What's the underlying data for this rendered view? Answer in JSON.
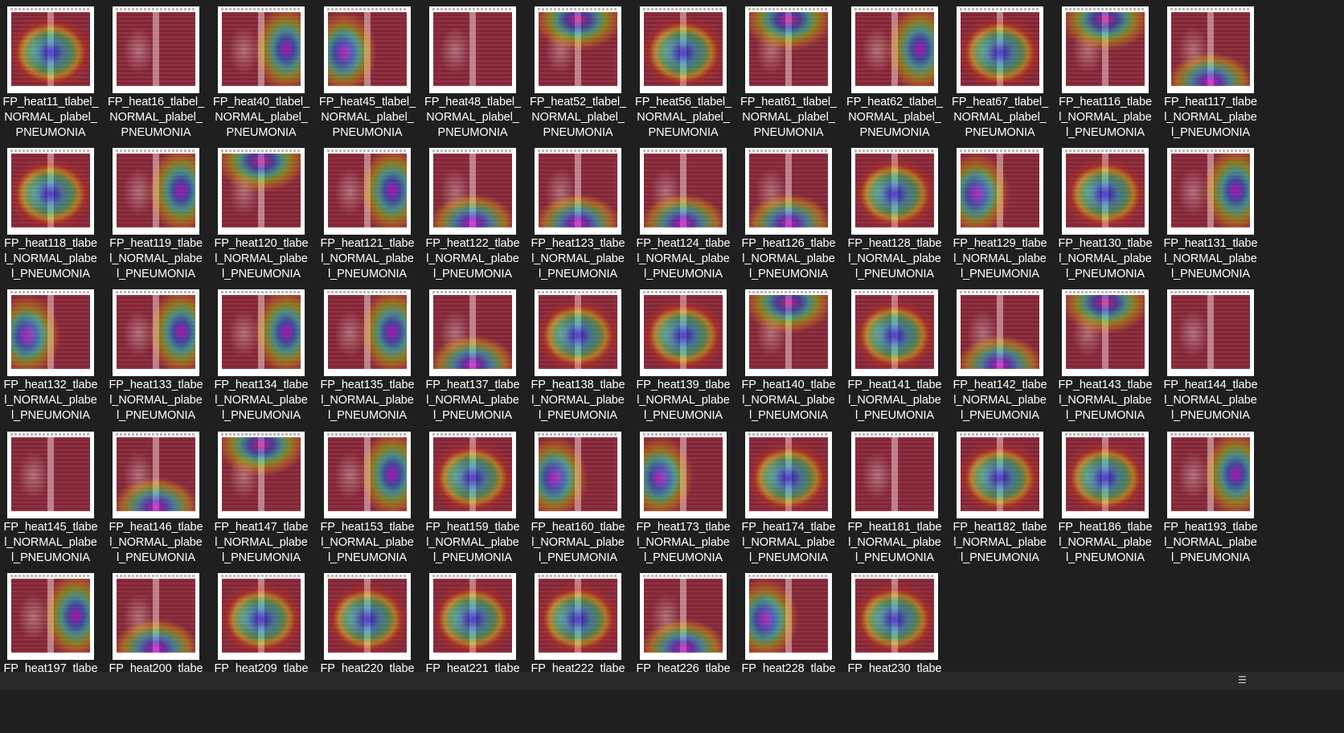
{
  "window": {
    "view": "thumbnails"
  },
  "colors": {
    "background": "#1f1f1f",
    "text": "#ffffff",
    "statusbar": "#2a2a2a"
  },
  "files": [
    {
      "name": "FP_heat11_tlabel_\nNORMAL_plabel_\nPNEUMONIA",
      "heat": "jet-center"
    },
    {
      "name": "FP_heat16_tlabel_\nNORMAL_plabel_\nPNEUMONIA",
      "heat": "none"
    },
    {
      "name": "FP_heat40_tlabel_\nNORMAL_plabel_\nPNEUMONIA",
      "heat": "jet-right"
    },
    {
      "name": "FP_heat45_tlabel_\nNORMAL_plabel_\nPNEUMONIA",
      "heat": "jet-left"
    },
    {
      "name": "FP_heat48_tlabel_\nNORMAL_plabel_\nPNEUMONIA",
      "heat": "none"
    },
    {
      "name": "FP_heat52_tlabel_\nNORMAL_plabel_\nPNEUMONIA",
      "heat": "jet-top"
    },
    {
      "name": "FP_heat56_tlabel_\nNORMAL_plabel_\nPNEUMONIA",
      "heat": "jet-center"
    },
    {
      "name": "FP_heat61_tlabel_\nNORMAL_plabel_\nPNEUMONIA",
      "heat": "jet-top"
    },
    {
      "name": "FP_heat62_tlabel_\nNORMAL_plabel_\nPNEUMONIA",
      "heat": "jet-right"
    },
    {
      "name": "FP_heat67_tlabel_\nNORMAL_plabel_\nPNEUMONIA",
      "heat": "jet-center"
    },
    {
      "name": "FP_heat116_tlabe\nl_NORMAL_plabe\nl_PNEUMONIA",
      "heat": "jet-top"
    },
    {
      "name": "FP_heat117_tlabe\nl_NORMAL_plabe\nl_PNEUMONIA",
      "heat": "jet-bottom"
    },
    {
      "name": "FP_heat118_tlabe\nl_NORMAL_plabe\nl_PNEUMONIA",
      "heat": "jet-center"
    },
    {
      "name": "FP_heat119_tlabe\nl_NORMAL_plabe\nl_PNEUMONIA",
      "heat": "jet-right"
    },
    {
      "name": "FP_heat120_tlabe\nl_NORMAL_plabe\nl_PNEUMONIA",
      "heat": "jet-top"
    },
    {
      "name": "FP_heat121_tlabe\nl_NORMAL_plabe\nl_PNEUMONIA",
      "heat": "jet-right"
    },
    {
      "name": "FP_heat122_tlabe\nl_NORMAL_plabe\nl_PNEUMONIA",
      "heat": "jet-bottom"
    },
    {
      "name": "FP_heat123_tlabe\nl_NORMAL_plabe\nl_PNEUMONIA",
      "heat": "jet-bottom"
    },
    {
      "name": "FP_heat124_tlabe\nl_NORMAL_plabe\nl_PNEUMONIA",
      "heat": "jet-bottom"
    },
    {
      "name": "FP_heat126_tlabe\nl_NORMAL_plabe\nl_PNEUMONIA",
      "heat": "jet-bottom"
    },
    {
      "name": "FP_heat128_tlabe\nl_NORMAL_plabe\nl_PNEUMONIA",
      "heat": "jet-center"
    },
    {
      "name": "FP_heat129_tlabe\nl_NORMAL_plabe\nl_PNEUMONIA",
      "heat": "jet-left"
    },
    {
      "name": "FP_heat130_tlabe\nl_NORMAL_plabe\nl_PNEUMONIA",
      "heat": "jet-center"
    },
    {
      "name": "FP_heat131_tlabe\nl_NORMAL_plabe\nl_PNEUMONIA",
      "heat": "jet-right"
    },
    {
      "name": "FP_heat132_tlabe\nl_NORMAL_plabe\nl_PNEUMONIA",
      "heat": "jet-left"
    },
    {
      "name": "FP_heat133_tlabe\nl_NORMAL_plabe\nl_PNEUMONIA",
      "heat": "jet-right"
    },
    {
      "name": "FP_heat134_tlabe\nl_NORMAL_plabe\nl_PNEUMONIA",
      "heat": "jet-right"
    },
    {
      "name": "FP_heat135_tlabe\nl_NORMAL_plabe\nl_PNEUMONIA",
      "heat": "jet-right"
    },
    {
      "name": "FP_heat137_tlabe\nl_NORMAL_plabe\nl_PNEUMONIA",
      "heat": "jet-bottom"
    },
    {
      "name": "FP_heat138_tlabe\nl_NORMAL_plabe\nl_PNEUMONIA",
      "heat": "jet-center"
    },
    {
      "name": "FP_heat139_tlabe\nl_NORMAL_plabe\nl_PNEUMONIA",
      "heat": "jet-center"
    },
    {
      "name": "FP_heat140_tlabe\nl_NORMAL_plabe\nl_PNEUMONIA",
      "heat": "jet-top"
    },
    {
      "name": "FP_heat141_tlabe\nl_NORMAL_plabe\nl_PNEUMONIA",
      "heat": "jet-center"
    },
    {
      "name": "FP_heat142_tlabe\nl_NORMAL_plabe\nl_PNEUMONIA",
      "heat": "jet-bottom"
    },
    {
      "name": "FP_heat143_tlabe\nl_NORMAL_plabe\nl_PNEUMONIA",
      "heat": "jet-top"
    },
    {
      "name": "FP_heat144_tlabe\nl_NORMAL_plabe\nl_PNEUMONIA",
      "heat": "none"
    },
    {
      "name": "FP_heat145_tlabe\nl_NORMAL_plabe\nl_PNEUMONIA",
      "heat": "none"
    },
    {
      "name": "FP_heat146_tlabe\nl_NORMAL_plabe\nl_PNEUMONIA",
      "heat": "jet-bottom"
    },
    {
      "name": "FP_heat147_tlabe\nl_NORMAL_plabe\nl_PNEUMONIA",
      "heat": "jet-top"
    },
    {
      "name": "FP_heat153_tlabe\nl_NORMAL_plabe\nl_PNEUMONIA",
      "heat": "jet-right"
    },
    {
      "name": "FP_heat159_tlabe\nl_NORMAL_plabe\nl_PNEUMONIA",
      "heat": "jet-center"
    },
    {
      "name": "FP_heat160_tlabe\nl_NORMAL_plabe\nl_PNEUMONIA",
      "heat": "jet-left"
    },
    {
      "name": "FP_heat173_tlabe\nl_NORMAL_plabe\nl_PNEUMONIA",
      "heat": "jet-left"
    },
    {
      "name": "FP_heat174_tlabe\nl_NORMAL_plabe\nl_PNEUMONIA",
      "heat": "jet-center"
    },
    {
      "name": "FP_heat181_tlabe\nl_NORMAL_plabe\nl_PNEUMONIA",
      "heat": "none"
    },
    {
      "name": "FP_heat182_tlabe\nl_NORMAL_plabe\nl_PNEUMONIA",
      "heat": "jet-center"
    },
    {
      "name": "FP_heat186_tlabe\nl_NORMAL_plabe\nl_PNEUMONIA",
      "heat": "jet-center"
    },
    {
      "name": "FP_heat193_tlabe\nl_NORMAL_plabe\nl_PNEUMONIA",
      "heat": "jet-right"
    },
    {
      "name": "FP_heat197_tlabe",
      "heat": "jet-right"
    },
    {
      "name": "FP_heat200_tlabe",
      "heat": "jet-bottom"
    },
    {
      "name": "FP_heat209_tlabe",
      "heat": "jet-center"
    },
    {
      "name": "FP_heat220_tlabe",
      "heat": "jet-center"
    },
    {
      "name": "FP_heat221_tlabe",
      "heat": "jet-center"
    },
    {
      "name": "FP_heat222_tlabe",
      "heat": "jet-center"
    },
    {
      "name": "FP_heat226_tlabe",
      "heat": "jet-bottom"
    },
    {
      "name": "FP_heat228_tlabe",
      "heat": "jet-left"
    },
    {
      "name": "FP_heat230_tlabe",
      "heat": "jet-center"
    }
  ],
  "statusbar": {
    "view_toggle_icon": "details-view-icon"
  }
}
